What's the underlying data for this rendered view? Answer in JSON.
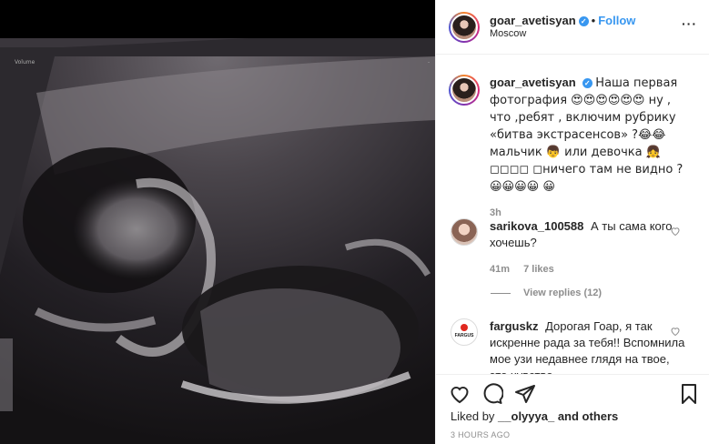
{
  "post": {
    "username": "goar_avetisyan",
    "verified_mark": "✓",
    "separator": "•",
    "follow_label": "Follow",
    "location": "Moscow",
    "more_label": "···"
  },
  "caption": {
    "username": "goar_avetisyan",
    "text": "Наша первая фотография 😍😍😍😍😍😍 ну , что ,ребят , включим рубрику «битва экстрасенсов» ?😂😂 мальчик 👦 или девочка 👧 ◻◻◻◻ ◻ничего там не видно ?😀😀😀😀 😀",
    "time": "3h"
  },
  "comments": [
    {
      "username": "sarikova_100588",
      "text": "А ты сама кого хочешь?",
      "time": "41m",
      "likes": "7 likes",
      "replies": "View replies (12)"
    },
    {
      "username": "farguskz",
      "text": "Дорогая Гоар, я так искренне рада за тебя!! Вспомнила мое узи недавнее глядя на твое, это чувство",
      "avatar_text": "FARGUS"
    }
  ],
  "actions": {
    "liked_prefix": "Liked by ",
    "liked_user": "__olyyya_",
    "liked_suffix": " and others",
    "timestamp": "3 HOURS AGO"
  },
  "icons": {
    "like": "heart-icon",
    "comment": "comment-icon",
    "share": "share-icon",
    "save": "bookmark-icon",
    "more": "more-options-icon"
  },
  "colors": {
    "accent": "#3897f0",
    "text": "#262626",
    "muted": "#8e8e8e",
    "border": "#efefef"
  }
}
